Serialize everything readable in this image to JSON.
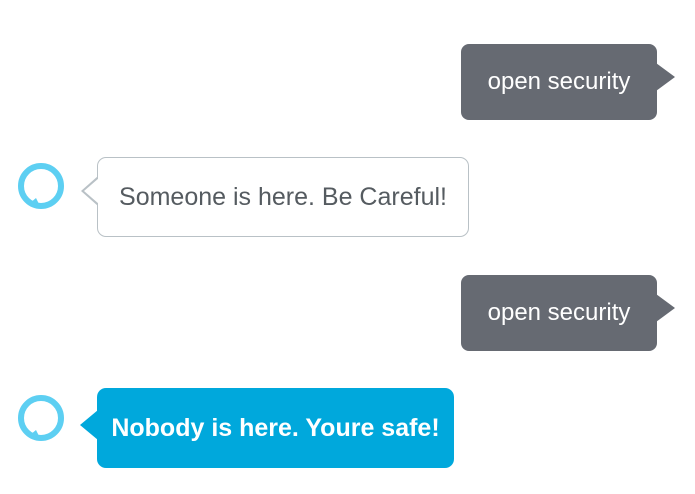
{
  "colors": {
    "user_bubble": "#666a72",
    "alexa_bubble_filled": "#00a8dc",
    "alexa_bubble_border": "#b9c1c6",
    "alexa_icon_ring": "#5dcff2"
  },
  "conversation": [
    {
      "sender": "user",
      "text": "open security"
    },
    {
      "sender": "alexa",
      "icon": "alexa-ring-icon",
      "style": "outlined",
      "text": "Someone is here. Be Careful!"
    },
    {
      "sender": "user",
      "text": "open security"
    },
    {
      "sender": "alexa",
      "icon": "alexa-ring-icon",
      "style": "filled",
      "text": "Nobody is here. Youre safe!"
    }
  ]
}
